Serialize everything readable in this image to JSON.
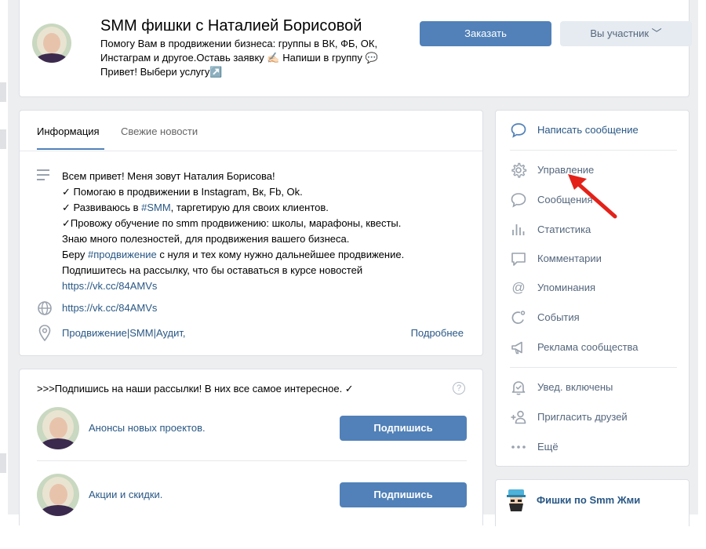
{
  "header": {
    "title": "SMM фишки с Наталией Борисовой",
    "status_line1": "Помогу Вам в продвижении бизнеса: группы в ВК, ФБ, ОК,",
    "status_line2": "Инстаграм и другое.Оставь заявку ✍🏻 Напиши в группу 💬",
    "status_line3": "Привет! Выбери услугу↗️",
    "order_button": "Заказать",
    "member_button": "Вы участник ﹀"
  },
  "info": {
    "tabs": [
      {
        "label": "Информация",
        "active": true
      },
      {
        "label": "Свежие новости",
        "active": false
      }
    ],
    "description": [
      "Всем привет! Меня зовут Наталия Борисова!",
      "✓ Помогаю в продвижении в Instagram, Вк, Fb, Ok.",
      "✓ Развиваюсь в ",
      "✓Провожу обучение по smm продвижению: школы, марафоны, квесты.",
      "Знаю много полезностей, для продвижения вашего бизнеса.",
      "Беру ",
      "Подпишитесь на рассылку, что бы оставаться в курсе новостей"
    ],
    "desc_line3_hashtag": "#SMM",
    "desc_line3_rest": ", таргетирую для своих клиентов.",
    "desc_line6_hashtag": "#продвижение",
    "desc_line6_rest": " с нуля и тех кому нужно дальнейшее продвижение.",
    "desc_link": "https://vk.cc/84AMVs",
    "site": "https://vk.cc/84AMVs",
    "place": "Продвижение|SMM|Аудит,",
    "more": "Подробнее"
  },
  "newsletter": {
    "title": ">>>Подпишись на наши рассылки! В них все самое интересное. ✓",
    "help": "?",
    "items": [
      {
        "label": "Анонсы новых проектов.",
        "button": "Подпишись"
      },
      {
        "label": "Акции и скидки.",
        "button": "Подпишись"
      }
    ]
  },
  "menu": {
    "items": [
      {
        "label": "Написать сообщение",
        "icon": "chat-bubble-icon"
      },
      {
        "label": "Управление",
        "icon": "gear-icon"
      },
      {
        "label": "Сообщения",
        "icon": "message-icon"
      },
      {
        "label": "Статистика",
        "icon": "stats-icon"
      },
      {
        "label": "Комментарии",
        "icon": "comments-icon"
      },
      {
        "label": "Упоминания",
        "icon": "at-icon"
      },
      {
        "label": "События",
        "icon": "events-icon"
      },
      {
        "label": "Реклама сообщества",
        "icon": "megaphone-icon"
      },
      {
        "label": "Увед. включены",
        "icon": "bell-icon"
      },
      {
        "label": "Пригласить друзей",
        "icon": "invite-icon"
      },
      {
        "label": "Ещё",
        "icon": "more-icon"
      }
    ]
  },
  "side_link": {
    "label": "Фишки по Smm Жми"
  },
  "colors": {
    "accent": "#5181b8",
    "link": "#2a5885",
    "background": "#edeef0",
    "annotation_arrow": "#e32119"
  }
}
